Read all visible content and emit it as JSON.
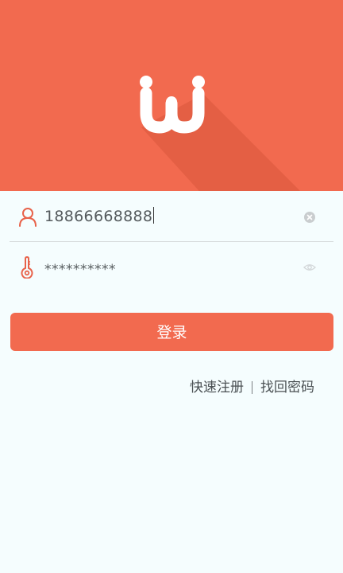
{
  "colors": {
    "accent": "#f26a4f",
    "background": "#f5fdfe"
  },
  "header": {
    "logo_icon": "wi-logo-icon"
  },
  "form": {
    "username": {
      "value": "18866668888",
      "lead_icon": "user-icon",
      "trail_icon": "clear-icon"
    },
    "password": {
      "value": "**********",
      "lead_icon": "key-icon",
      "trail_icon": "eye-icon"
    }
  },
  "login_button": {
    "label": "登录"
  },
  "links": {
    "register": "快速注册",
    "forgot": "找回密码"
  }
}
